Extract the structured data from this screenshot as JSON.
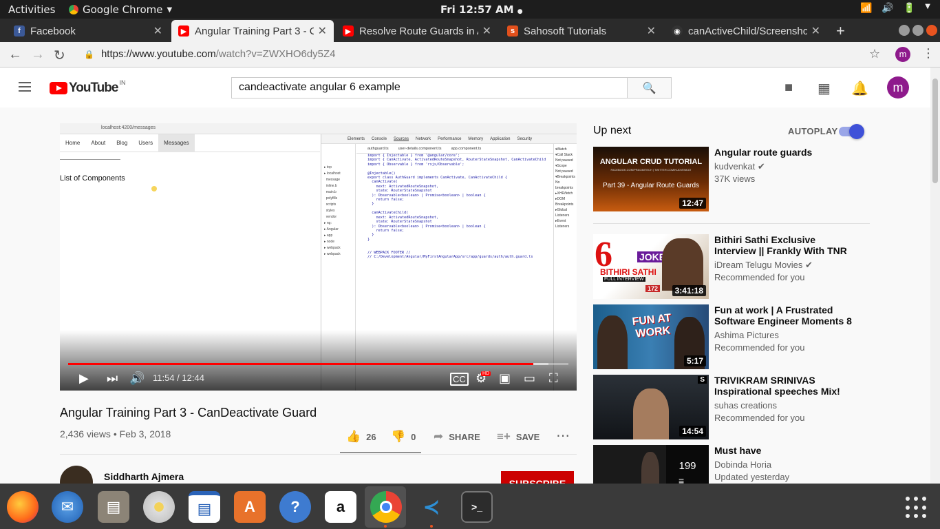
{
  "gnome": {
    "activities": "Activities",
    "app_name": "Google Chrome",
    "clock": "Fri 12:57 AM"
  },
  "tabs": [
    {
      "title": "Facebook",
      "favicon": "facebook-icon",
      "color": "#3b5998"
    },
    {
      "title": "Angular Training Part 3 - C",
      "favicon": "youtube-icon",
      "color": "#ff0000"
    },
    {
      "title": "Resolve Route Guards in A",
      "favicon": "youtube-icon",
      "color": "#ff0000"
    },
    {
      "title": "Sahosoft Tutorials",
      "favicon": "sahosoft-icon",
      "color": "#e2501c"
    },
    {
      "title": "canActiveChild/Screensho",
      "favicon": "github-icon",
      "color": "#333333"
    }
  ],
  "toolbar": {
    "url_host": "https://www.youtube.com",
    "url_path": "/watch?v=ZWXHO6dy5Z4",
    "profile_initial": "m"
  },
  "youtube": {
    "logo_text": "YouTube",
    "region": "IN",
    "search_value": "candeactivate angular 6 example",
    "avatar_initial": "m"
  },
  "player": {
    "inner_url": "localhost:4200/messages",
    "inner_nav": [
      "Home",
      "About",
      "Blog",
      "Users",
      "Messages"
    ],
    "inner_heading": "List of Components",
    "devtools_tabs": [
      "Elements",
      "Console",
      "Sources",
      "Network",
      "Performance",
      "Memory",
      "Application",
      "Security"
    ],
    "devtools_files": [
      "authguard.ts",
      "user-details.component.ts",
      "app.component.ts"
    ],
    "code_lines": "import { Injectable } from '@angular/core';\nimport { CanActivate, ActivatedRouteSnapshot, RouterStateSnapshot, CanActivateChild\nimport { Observable } from 'rxjs/Observable';\n\n@Injectable()\nexport class AuthGuard implements CanActivate, CanActivateChild {\n  canActivate(\n    next: ActivatedRouteSnapshot,\n    state: RouterStateSnapshot\n  ): Observable<boolean> | Promise<boolean> | boolean {\n    return false;\n  }\n\n  canActivateChild(\n    next: ActivatedRouteSnapshot,\n    state: RouterStateSnapshot\n  ): Observable<boolean> | Promise<boolean> | boolean {\n    return false;\n  }\n}\n\n\n// WEBPACK FOOTER //\n// C:/Development/Angular/MyFirstAngularApp/src/app/guards/auth/auth.guard.ts",
    "progress": 0.93,
    "buffered": 0.96,
    "time_current": "11:54",
    "time_total": "12:44",
    "time_readout": "11:54 / 12:44"
  },
  "video": {
    "title": "Angular Training Part 3 - CanDeactivate Guard",
    "stats": "2,436 views • Feb 3, 2018",
    "likes": "26",
    "dislikes": "0",
    "share_label": "SHARE",
    "save_label": "SAVE",
    "channel": "Siddharth Ajmera",
    "subscribe_label": "SUBSCRIBE"
  },
  "sidebar": {
    "up_next_label": "Up next",
    "autoplay_label": "AUTOPLAY",
    "autoplay_on": true,
    "items": [
      {
        "title": "Angular route guards",
        "channel": "kudvenkat",
        "verified": true,
        "meta": "37K views",
        "duration": "12:47",
        "thumb_text": "ANGULAR CRUD TUTORIAL",
        "thumb_sub": "Part 39 - Angular Route Guards",
        "thumb_credit": "FACEBOOK.COM/PRAGIMTECH | TWITTER.COM/KUDVENKAT"
      },
      {
        "title": "Bithiri Sathi Exclusive Interview || Frankly With TNR #172 |...",
        "channel": "iDream Telugu Movies",
        "verified": true,
        "meta": "Recommended for you",
        "duration": "3:41:18",
        "thumb_text": "BITHIRI SATHI",
        "thumb_sub": "FULL INTERVIEW",
        "thumb_badge": "172",
        "thumb_extra": "JOKER"
      },
      {
        "title": "Fun at work | A Frustrated Software Engineer Moments 8",
        "channel": "Ashima Pictures",
        "verified": false,
        "meta": "Recommended for you",
        "duration": "5:17",
        "thumb_text": "FUN AT WORK"
      },
      {
        "title": "TRIVIKRAM SRINIVAS Inspirational speeches Mix!",
        "channel": "suhas creations",
        "verified": false,
        "meta": "Recommended for you",
        "duration": "14:54"
      },
      {
        "title": "Must have",
        "channel": "Dobinda Horia",
        "verified": false,
        "meta": "Updated yesterday",
        "count": "199"
      }
    ]
  },
  "dock": [
    "Firefox",
    "Thunderbird",
    "Files",
    "Rhythmbox",
    "LibreOffice Writer",
    "Ubuntu Software",
    "Help",
    "Amazon",
    "Google Chrome",
    "Visual Studio Code",
    "Terminal"
  ],
  "colors": {
    "youtube_red": "#ff0000",
    "subscribe": "#cc0000",
    "autoplay": "#3f51d8",
    "profile": "#8e1a8c"
  }
}
